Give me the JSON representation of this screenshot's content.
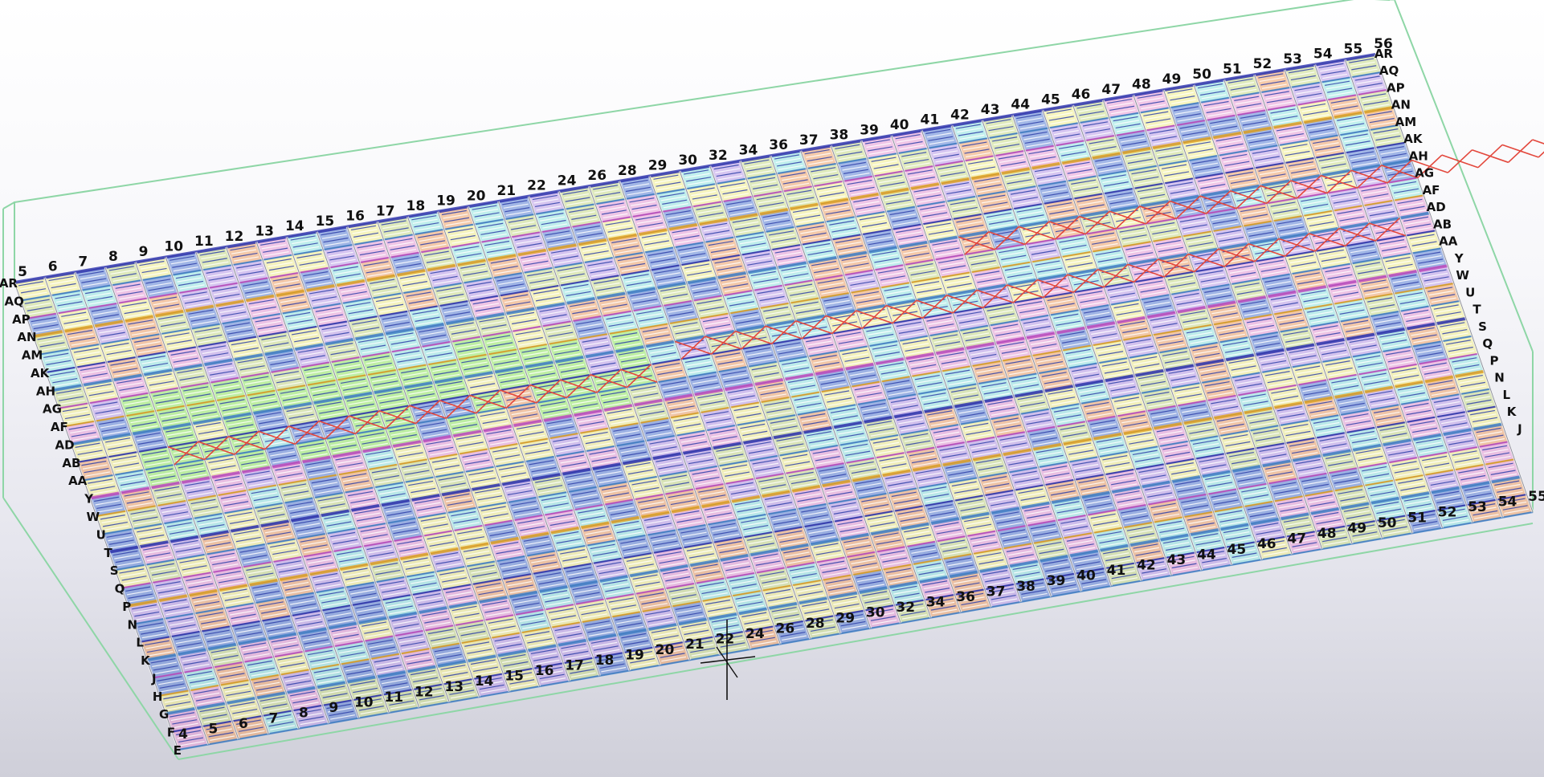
{
  "viewport": {
    "top_grid_labels": [
      "5",
      "6",
      "7",
      "8",
      "9",
      "10",
      "11",
      "12",
      "13",
      "14",
      "15",
      "16",
      "17",
      "18",
      "19",
      "20",
      "21",
      "22",
      "24",
      "26",
      "28",
      "29",
      "30",
      "32",
      "34",
      "36",
      "37",
      "38",
      "39",
      "40",
      "41",
      "42",
      "43",
      "44",
      "45",
      "46",
      "47",
      "48",
      "49",
      "50",
      "51",
      "52",
      "53",
      "54",
      "55",
      "56"
    ],
    "bottom_grid_labels": [
      "4",
      "5",
      "6",
      "7",
      "8",
      "9",
      "10",
      "11",
      "12",
      "13",
      "14",
      "15",
      "16",
      "17",
      "18",
      "19",
      "20",
      "21",
      "22",
      "24",
      "26",
      "28",
      "29",
      "30",
      "32",
      "34",
      "36",
      "37",
      "38",
      "39",
      "40",
      "41",
      "42",
      "43",
      "44",
      "45",
      "46",
      "47",
      "48",
      "49",
      "50",
      "51",
      "52",
      "53",
      "54",
      "55"
    ],
    "left_grid_labels": [
      "AR",
      "AQ",
      "AP",
      "AN",
      "AM",
      "AK",
      "AH",
      "AG",
      "AF",
      "AD",
      "AB",
      "AA",
      "Y",
      "W",
      "U",
      "T",
      "S",
      "Q",
      "P",
      "N",
      "L",
      "K",
      "J",
      "H",
      "G",
      "F",
      "E"
    ],
    "right_grid_labels": [
      "AR",
      "AQ",
      "AP",
      "AN",
      "AM",
      "AK",
      "AH",
      "AG",
      "AF",
      "AD",
      "AB",
      "AA",
      "Y",
      "W",
      "U",
      "T",
      "S",
      "Q",
      "P",
      "N",
      "L",
      "K",
      "J"
    ],
    "colors": {
      "bay_blue": "#5a7fd6",
      "bay_cyan": "#8fe6e0",
      "bay_green": "#c9dd86",
      "bay_orange": "#f0a266",
      "bay_pink": "#e89ad6",
      "bay_violet": "#b99be8",
      "bay_yellow": "#f3ef8a",
      "bay_light_green": "#93ec5e",
      "beam_navy": "#2a2fae",
      "beam_steel": "#3f7fc8",
      "beam_magenta": "#c24ac0",
      "beam_amber": "#e3a21e",
      "brace_red": "#e3473c",
      "bounding_box": "#8ed6a6"
    },
    "cursor_icon": "crosshair-cursor-icon"
  }
}
